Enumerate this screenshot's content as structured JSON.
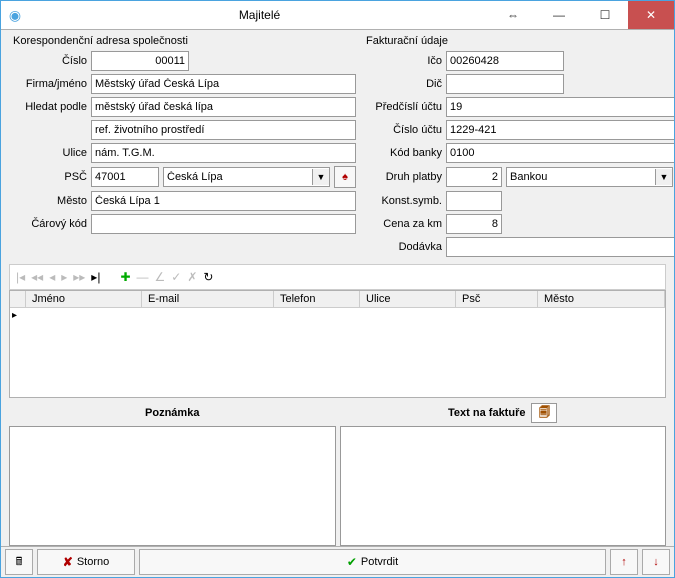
{
  "title": "Majitelé",
  "left_group": "Korespondenční adresa společnosti",
  "right_group": "Fakturační údaje",
  "fields": {
    "cislo_label": "Číslo",
    "cislo_value": "00011",
    "firma_label": "Firma/jméno",
    "firma_value": "Městský úřad Česká Lípa",
    "hledat_label": "Hledat podle",
    "hledat_value": "městský úřad česká lípa",
    "ref_value": "ref. životního prostředí",
    "ulice_label": "Ulice",
    "ulice_value": "nám. T.G.M.",
    "psc_label": "PSČ",
    "psc_value": "47001",
    "psc_city_value": "Česká Lípa",
    "mesto_label": "Město",
    "mesto_value": "Česká Lípa 1",
    "carovy_label": "Čárový kód",
    "carovy_value": "",
    "ico_label": "Ičo",
    "ico_value": "00260428",
    "dic_label": "Dič",
    "dic_value": "",
    "predcisli_label": "Předčíslí účtu",
    "predcisli_value": "19",
    "cislouctu_label": "Číslo účtu",
    "cislouctu_value": "1229-421",
    "kodbanky_label": "Kód banky",
    "kodbanky_value": "0100",
    "druh_label": "Druh platby",
    "druh_value": "2",
    "druh_text": "Bankou",
    "konst_label": "Konst.symb.",
    "konst_value": "",
    "cenakm_label": "Cena za km",
    "cenakm_value": "8",
    "dodavka_label": "Dodávka",
    "dodavka_value": ""
  },
  "grid_headers": [
    "Jméno",
    "E-mail",
    "Telefon",
    "Ulice",
    "Psč",
    "Město"
  ],
  "poznamka_label": "Poznámka",
  "textfak_label": "Text na faktuře",
  "storno_label": "Storno",
  "potvrdit_label": "Potvrdit"
}
